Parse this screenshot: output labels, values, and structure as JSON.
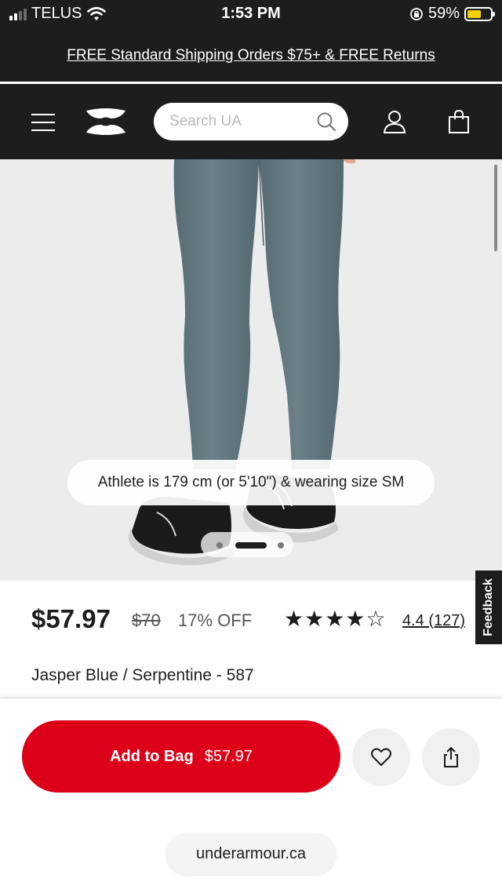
{
  "status_bar": {
    "carrier": "TELUS",
    "time": "1:53 PM",
    "battery": "59%",
    "battery_level": 0.59,
    "icons": [
      "signal-icon",
      "wifi-icon",
      "orientation-lock-icon",
      "battery-icon"
    ]
  },
  "promo": {
    "text": "FREE Standard Shipping Orders $75+ & FREE Returns"
  },
  "header": {
    "search_placeholder": "Search UA",
    "icons": [
      "menu-icon",
      "brand-logo",
      "search-icon",
      "account-icon",
      "bag-icon"
    ]
  },
  "hero": {
    "caption": "Athlete is 179 cm (or 5'10\") & wearing size SM",
    "carousel_pages": 3,
    "carousel_active": 2
  },
  "feedback": {
    "label": "Feedback"
  },
  "product": {
    "price": "$57.97",
    "original_price": "$70",
    "discount": "17% OFF",
    "stars": "★★★★☆",
    "rating_value": 4.4,
    "rating_text": "4.4 (127)",
    "color": "Jasper Blue / Serpentine - 587"
  },
  "actions": {
    "add_to_bag_label": "Add to Bag",
    "add_to_bag_price": "$57.97",
    "icons": [
      "heart-icon",
      "share-icon"
    ]
  },
  "browser": {
    "domain": "underarmour.ca"
  },
  "colors": {
    "header_bg": "#1d1d1d",
    "accent_red": "#dc0019",
    "battery_yellow": "#f5d000",
    "legging": "#62777d"
  }
}
